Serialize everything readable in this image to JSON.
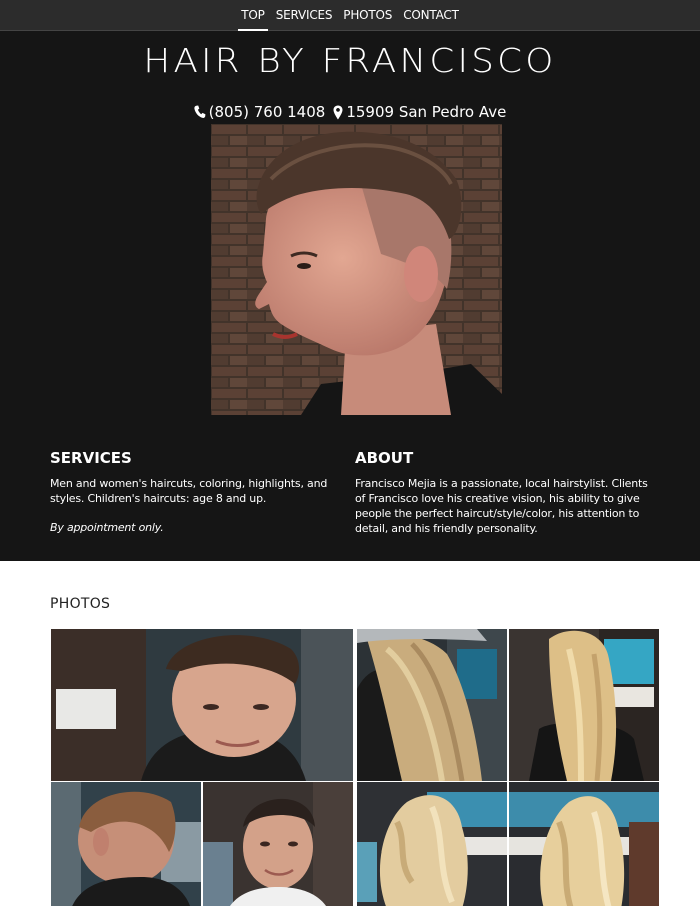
{
  "nav": {
    "items": [
      {
        "label": "TOP",
        "active": true
      },
      {
        "label": "SERVICES",
        "active": false
      },
      {
        "label": "PHOTOS",
        "active": false
      },
      {
        "label": "CONTACT",
        "active": false
      }
    ]
  },
  "header": {
    "title": "HAIR BY FRANCISCO",
    "phone": "(805) 760 1408",
    "address": "15909 San Pedro Ave"
  },
  "services": {
    "heading": "SERVICES",
    "text": "Men and women's haircuts, coloring, highlights, and styles. Children's haircuts: age 8 and up.",
    "note": "By appointment only."
  },
  "about": {
    "heading": "ABOUT",
    "text": "Francisco Mejia is a passionate, local hairstylist. Clients of Francisco love his creative vision, his ability to give people the perfect haircut/style/color, his attention to detail, and his friendly personality."
  },
  "photos": {
    "heading": "PHOTOS"
  },
  "colors": {
    "nav_bg": "#2c2c2c",
    "hero_bg": "#151515",
    "text_light": "#ffffff"
  }
}
